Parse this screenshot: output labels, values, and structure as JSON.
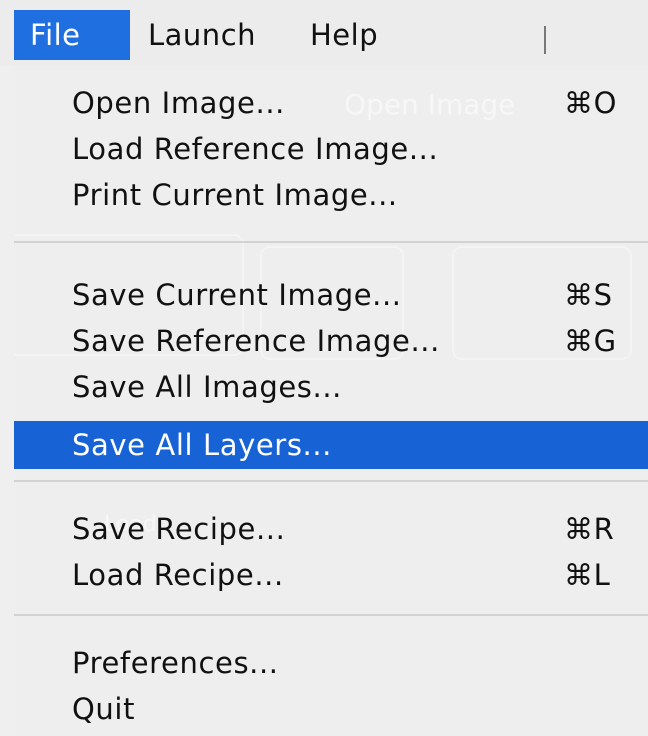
{
  "menubar": {
    "items": [
      {
        "label": "File",
        "active": true
      },
      {
        "label": "Launch",
        "active": false
      },
      {
        "label": "Help",
        "active": false
      }
    ]
  },
  "file_menu": {
    "groups": [
      [
        {
          "label": "Open Image...",
          "shortcut": "⌘O"
        },
        {
          "label": "Load Reference Image...",
          "shortcut": ""
        },
        {
          "label": "Print Current Image...",
          "shortcut": ""
        }
      ],
      [
        {
          "label": "Save Current Image...",
          "shortcut": "⌘S"
        },
        {
          "label": "Save Reference Image...",
          "shortcut": "⌘G"
        },
        {
          "label": "Save All Images...",
          "shortcut": ""
        },
        {
          "label": "Save All Layers...",
          "shortcut": "",
          "highlighted": true
        }
      ],
      [
        {
          "label": "Save Recipe...",
          "shortcut": "⌘R"
        },
        {
          "label": "Load Recipe...",
          "shortcut": "⌘L"
        }
      ],
      [
        {
          "label": "Preferences...",
          "shortcut": ""
        },
        {
          "label": "Quit",
          "shortcut": ""
        }
      ]
    ]
  },
  "background_window": {
    "open_image_button": "Open Image",
    "load_label": "Load"
  },
  "colors": {
    "highlight": "#1762d4",
    "menubar_active": "#1f6fe0",
    "menu_background": "#eeeeee",
    "separator": "#d2d2d2"
  }
}
